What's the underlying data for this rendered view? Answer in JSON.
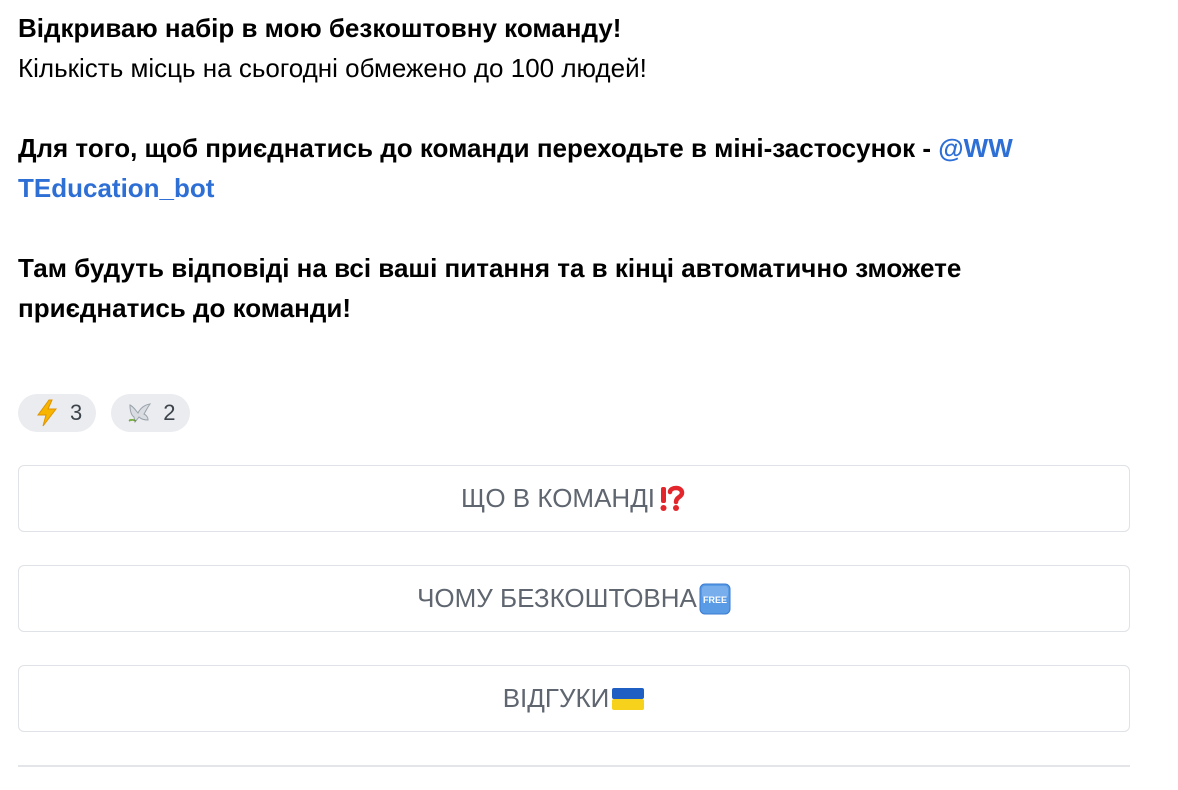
{
  "message": {
    "line1": "Відкриваю набір в мою безкоштовну команду!",
    "line2": "Кількість місць на сьогодні обмежено до 100 людей!",
    "line3_text": "Для того, щоб приєднатись до команди переходьте в міні-застосунок - ",
    "line3_link": "@WW",
    "line4_link": "TEducation_bot",
    "line5": "Там будуть відповіді на всі ваші питання та в кінці автоматично зможете",
    "line6": "приєднатись до команди!"
  },
  "reactions": [
    {
      "icon": "lightning-icon",
      "count": "3"
    },
    {
      "icon": "dove-icon",
      "count": "2"
    }
  ],
  "buttons": [
    {
      "label": "ЩО В КОМАНДІ",
      "emoji": "exclamation-question-icon"
    },
    {
      "label": "ЧОМУ БЕЗКОШТОВНА ",
      "emoji": "free-icon"
    },
    {
      "label": "ВІДГУКИ",
      "emoji": "ukraine-flag-icon"
    }
  ],
  "colors": {
    "link": "#2e6fd6",
    "button_text": "#5f6670",
    "reaction_bg": "#eaecef"
  }
}
